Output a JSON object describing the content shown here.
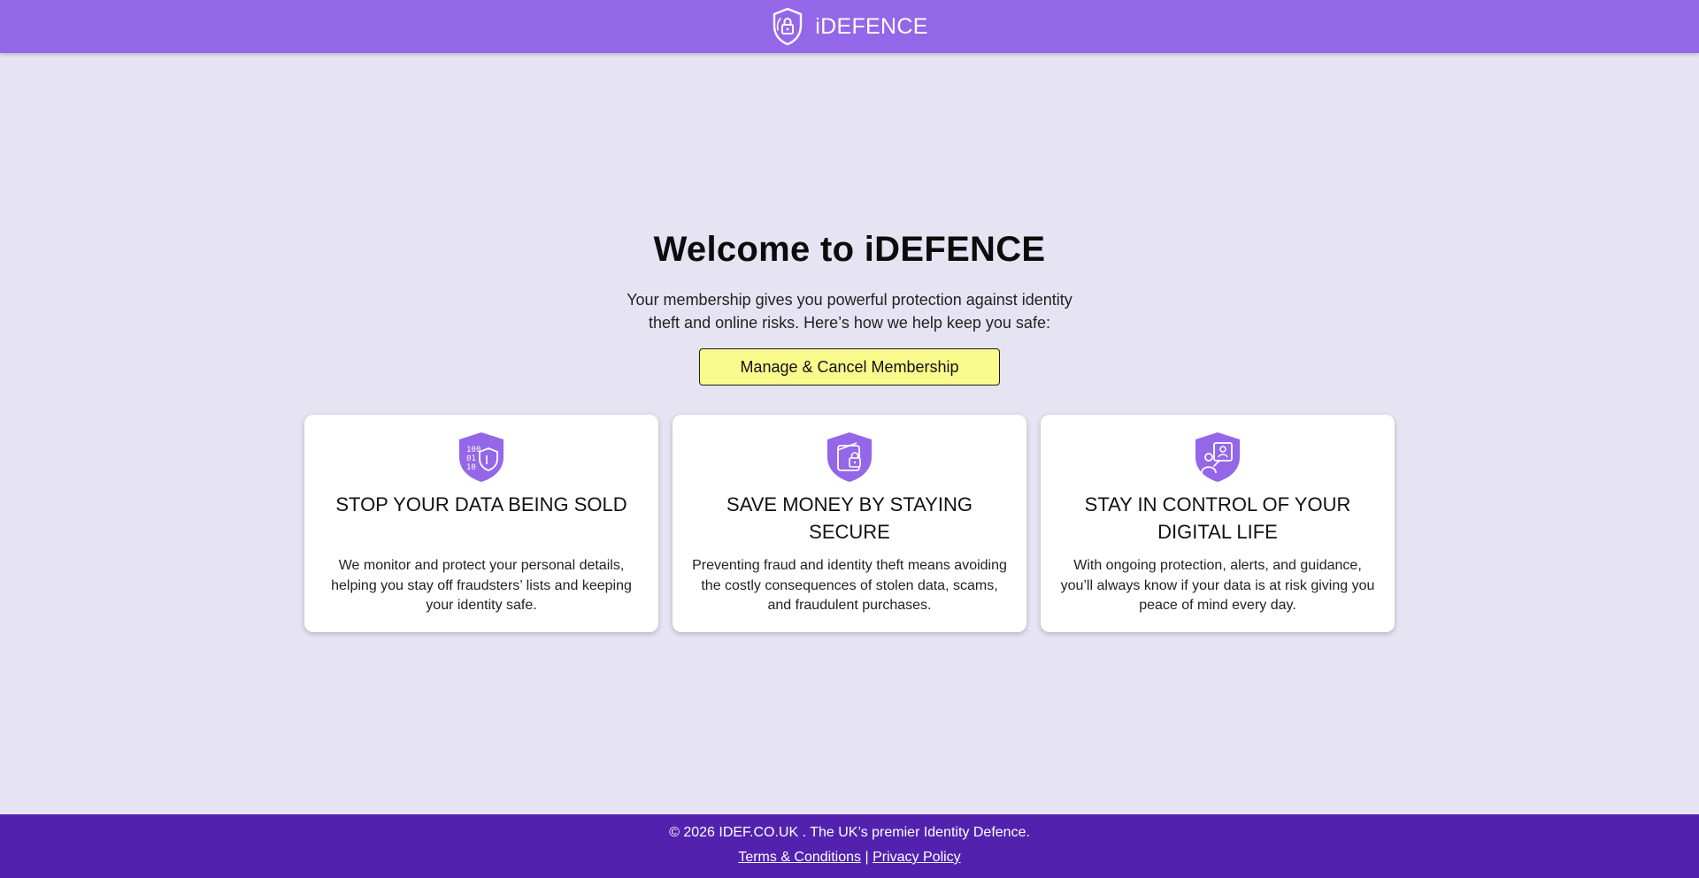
{
  "header": {
    "brand_name": "iDEFENCE"
  },
  "hero": {
    "title": "Welcome to iDEFENCE",
    "lead": "Your membership gives you powerful protection against identity theft and online risks. Here’s how we help keep you safe:",
    "cta_label": "Manage & Cancel Membership"
  },
  "cards": [
    {
      "icon": "data-shield-icon",
      "title": "STOP YOUR DATA BEING SOLD",
      "text": "We monitor and protect your personal details, helping you stay off fraudsters’ lists and keeping your identity safe."
    },
    {
      "icon": "wallet-lock-icon",
      "title": "SAVE MONEY BY STAYING SECURE",
      "text": "Preventing fraud and identity theft means avoiding the costly consequences of stolen data, scams, and fraudulent purchases."
    },
    {
      "icon": "user-screen-icon",
      "title": "STAY IN CONTROL OF YOUR DIGITAL LIFE",
      "text": "With ongoing protection, alerts, and guidance, you’ll always know if your data is at risk giving you peace of mind every day."
    }
  ],
  "footer": {
    "copyright": "© 2026 IDEF.CO.UK . The UK’s premier Identity Defence.",
    "terms_label": "Terms & Conditions",
    "separator": "|",
    "privacy_label": "Privacy Policy"
  },
  "colors": {
    "header_bg": "#9466e8",
    "page_bg": "#e6e3f2",
    "cta_bg": "#fafb8d",
    "footer_bg": "#5222ae",
    "icon_purple": "#9466e8"
  }
}
